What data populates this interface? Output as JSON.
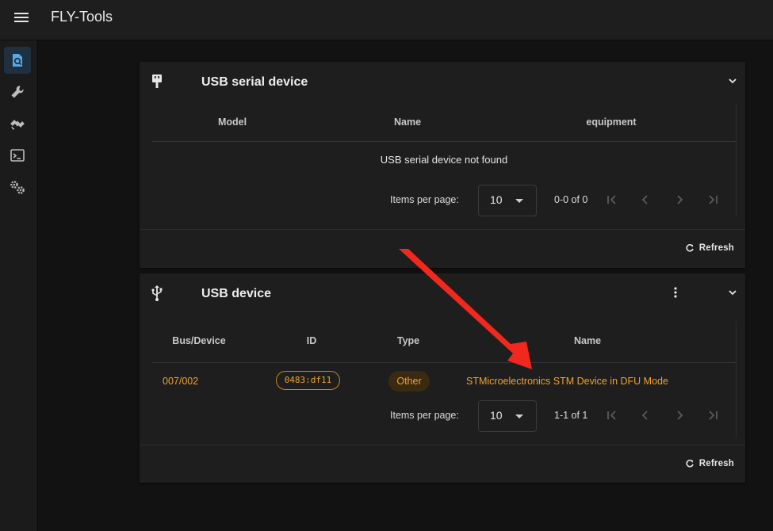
{
  "app": {
    "title": "FLY-Tools"
  },
  "rail": {
    "items": [
      {
        "icon": "device-search-icon",
        "active": true
      },
      {
        "icon": "wrench-icon",
        "active": false
      },
      {
        "icon": "satellite-icon",
        "active": false
      },
      {
        "icon": "terminal-icon",
        "active": false
      },
      {
        "icon": "gears-icon",
        "active": false
      }
    ]
  },
  "serial_card": {
    "title": "USB serial device",
    "columns": [
      "Model",
      "Name",
      "equipment"
    ],
    "empty_text": "USB serial device not found",
    "pager": {
      "items_per_page_label": "Items per page:",
      "items_per_page": "10",
      "range": "0-0 of 0"
    },
    "refresh_label": "Refresh"
  },
  "usb_card": {
    "title": "USB device",
    "columns": [
      "Bus/Device",
      "ID",
      "Type",
      "Name"
    ],
    "rows": [
      {
        "bus_device": "007/002",
        "id": "0483:df11",
        "type": "Other",
        "name": "STMicroelectronics STM Device in DFU Mode"
      }
    ],
    "pager": {
      "items_per_page_label": "Items per page:",
      "items_per_page": "10",
      "range": "1-1 of 1"
    },
    "refresh_label": "Refresh"
  },
  "colors": {
    "accent": "#f2a12a",
    "arrow": "#f0281e",
    "active_rail": "#1f3140",
    "rail_icon_active": "#5aa8e6"
  }
}
